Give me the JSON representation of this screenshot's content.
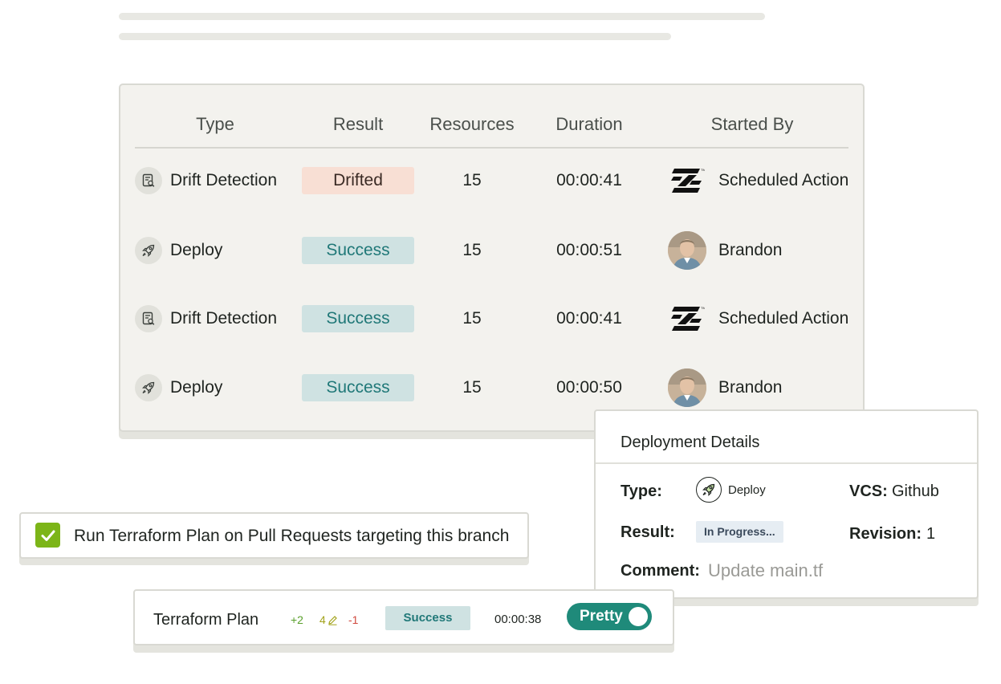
{
  "table": {
    "headers": {
      "type": "Type",
      "result": "Result",
      "resources": "Resources",
      "duration": "Duration",
      "started_by": "Started By"
    },
    "rows": [
      {
        "type": "Drift Detection",
        "type_icon": "drift-detection-icon",
        "result": "Drifted",
        "result_status": "drifted",
        "resources": "15",
        "duration": "00:00:41",
        "started_by": "Scheduled Action",
        "starter_icon": "scheduled-action-logo"
      },
      {
        "type": "Deploy",
        "type_icon": "rocket-icon",
        "result": "Success",
        "result_status": "success",
        "resources": "15",
        "duration": "00:00:51",
        "started_by": "Brandon",
        "starter_icon": "avatar"
      },
      {
        "type": "Drift Detection",
        "type_icon": "drift-detection-icon",
        "result": "Success",
        "result_status": "success",
        "resources": "15",
        "duration": "00:00:41",
        "started_by": "Scheduled Action",
        "starter_icon": "scheduled-action-logo"
      },
      {
        "type": "Deploy",
        "type_icon": "rocket-icon",
        "result": "Success",
        "result_status": "success",
        "resources": "15",
        "duration": "00:00:50",
        "started_by": "Brandon",
        "starter_icon": "avatar"
      }
    ]
  },
  "pr_option": {
    "checked": true,
    "label": "Run Terraform Plan on Pull Requests targeting this branch"
  },
  "details": {
    "title": "Deployment Details",
    "type_key": "Type:",
    "type_value": "Deploy",
    "vcs_key": "VCS:",
    "vcs_value": "Github",
    "result_key": "Result:",
    "result_value": "In Progress...",
    "revision_key": "Revision:",
    "revision_value": "1",
    "comment_key": "Comment:",
    "comment_value": "Update main.tf"
  },
  "plan": {
    "title": "Terraform Plan",
    "added": "+2",
    "changed": "4",
    "removed": "-1",
    "status": "Success",
    "duration": "00:00:38",
    "toggle_label": "Pretty",
    "toggle_on": true
  },
  "colors": {
    "success_bg": "#cfe2e2",
    "success_text": "#207878",
    "drifted_bg": "#f8dfd4",
    "checkbox": "#7cb518",
    "toggle": "#1f8a7a"
  }
}
